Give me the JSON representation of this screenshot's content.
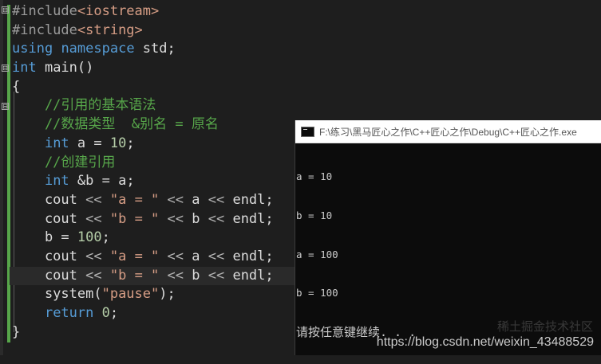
{
  "editor": {
    "lines": [
      [
        {
          "t": "#include",
          "c": "t-pre"
        },
        {
          "t": "<iostream>",
          "c": "t-inc"
        }
      ],
      [
        {
          "t": "#include",
          "c": "t-pre"
        },
        {
          "t": "<string>",
          "c": "t-inc"
        }
      ],
      [
        {
          "t": "using",
          "c": "t-kw"
        },
        {
          "t": " ",
          "c": "t-id"
        },
        {
          "t": "namespace",
          "c": "t-kw"
        },
        {
          "t": " std;",
          "c": "t-id"
        }
      ],
      [
        {
          "t": "int",
          "c": "t-kw"
        },
        {
          "t": " main()",
          "c": "t-id"
        }
      ],
      [
        {
          "t": "{",
          "c": "t-id"
        }
      ],
      [
        {
          "t": "    //引用的基本语法",
          "c": "t-cm"
        }
      ],
      [
        {
          "t": "    //数据类型  &别名 = 原名",
          "c": "t-cm"
        }
      ],
      [
        {
          "t": "    ",
          "c": "t-id"
        },
        {
          "t": "int",
          "c": "t-kw"
        },
        {
          "t": " a = ",
          "c": "t-id"
        },
        {
          "t": "10",
          "c": "t-num"
        },
        {
          "t": ";",
          "c": "t-id"
        }
      ],
      [
        {
          "t": "    //创建引用",
          "c": "t-cm"
        }
      ],
      [
        {
          "t": "    ",
          "c": "t-id"
        },
        {
          "t": "int",
          "c": "t-kw"
        },
        {
          "t": " &b = a;",
          "c": "t-id"
        }
      ],
      [
        {
          "t": "    cout ",
          "c": "t-id"
        },
        {
          "t": "<<",
          "c": "t-op"
        },
        {
          "t": " ",
          "c": "t-id"
        },
        {
          "t": "\"a = \"",
          "c": "t-str"
        },
        {
          "t": " ",
          "c": "t-id"
        },
        {
          "t": "<<",
          "c": "t-op"
        },
        {
          "t": " a ",
          "c": "t-id"
        },
        {
          "t": "<<",
          "c": "t-op"
        },
        {
          "t": " endl;",
          "c": "t-id"
        }
      ],
      [
        {
          "t": "    cout ",
          "c": "t-id"
        },
        {
          "t": "<<",
          "c": "t-op"
        },
        {
          "t": " ",
          "c": "t-id"
        },
        {
          "t": "\"b = \"",
          "c": "t-str"
        },
        {
          "t": " ",
          "c": "t-id"
        },
        {
          "t": "<<",
          "c": "t-op"
        },
        {
          "t": " b ",
          "c": "t-id"
        },
        {
          "t": "<<",
          "c": "t-op"
        },
        {
          "t": " endl;",
          "c": "t-id"
        }
      ],
      [
        {
          "t": "    b = ",
          "c": "t-id"
        },
        {
          "t": "100",
          "c": "t-num"
        },
        {
          "t": ";",
          "c": "t-id"
        }
      ],
      [
        {
          "t": "    cout ",
          "c": "t-id"
        },
        {
          "t": "<<",
          "c": "t-op"
        },
        {
          "t": " ",
          "c": "t-id"
        },
        {
          "t": "\"a = \"",
          "c": "t-str"
        },
        {
          "t": " ",
          "c": "t-id"
        },
        {
          "t": "<<",
          "c": "t-op"
        },
        {
          "t": " a ",
          "c": "t-id"
        },
        {
          "t": "<<",
          "c": "t-op"
        },
        {
          "t": " endl;",
          "c": "t-id"
        }
      ],
      [
        {
          "t": "    cout ",
          "c": "t-id"
        },
        {
          "t": "<<",
          "c": "t-op"
        },
        {
          "t": " ",
          "c": "t-id"
        },
        {
          "t": "\"b = \"",
          "c": "t-str"
        },
        {
          "t": " ",
          "c": "t-id"
        },
        {
          "t": "<<",
          "c": "t-op"
        },
        {
          "t": " b ",
          "c": "t-id"
        },
        {
          "t": "<<",
          "c": "t-op"
        },
        {
          "t": " endl;",
          "c": "t-id"
        }
      ],
      [
        {
          "t": "    system(",
          "c": "t-id"
        },
        {
          "t": "\"pause\"",
          "c": "t-str"
        },
        {
          "t": ");",
          "c": "t-id"
        }
      ],
      [
        {
          "t": "    ",
          "c": "t-id"
        },
        {
          "t": "return",
          "c": "t-kw"
        },
        {
          "t": " ",
          "c": "t-id"
        },
        {
          "t": "0",
          "c": "t-num"
        },
        {
          "t": ";",
          "c": "t-id"
        }
      ],
      [
        {
          "t": "}",
          "c": "t-id"
        }
      ]
    ],
    "fold_markers": [
      "⊟",
      "⊟",
      "⊟"
    ],
    "colors": {
      "background": "#1e1e1e",
      "keyword": "#569cd6",
      "comment": "#57a64a",
      "string": "#d69d85",
      "number": "#b5cea8",
      "change_bar": "#57a64a"
    }
  },
  "console": {
    "icon": "console-app-icon",
    "title": "F:\\练习\\黑马匠心之作\\C++匠心之作\\Debug\\C++匠心之作.exe",
    "output_lines": [
      "a = 10",
      "b = 10",
      "a = 100",
      "b = 100"
    ],
    "prompt": "请按任意键继续. . ."
  },
  "watermark": {
    "url": "https://blog.csdn.net/weixin_43488529",
    "faint": "稀土掘金技术社区"
  }
}
